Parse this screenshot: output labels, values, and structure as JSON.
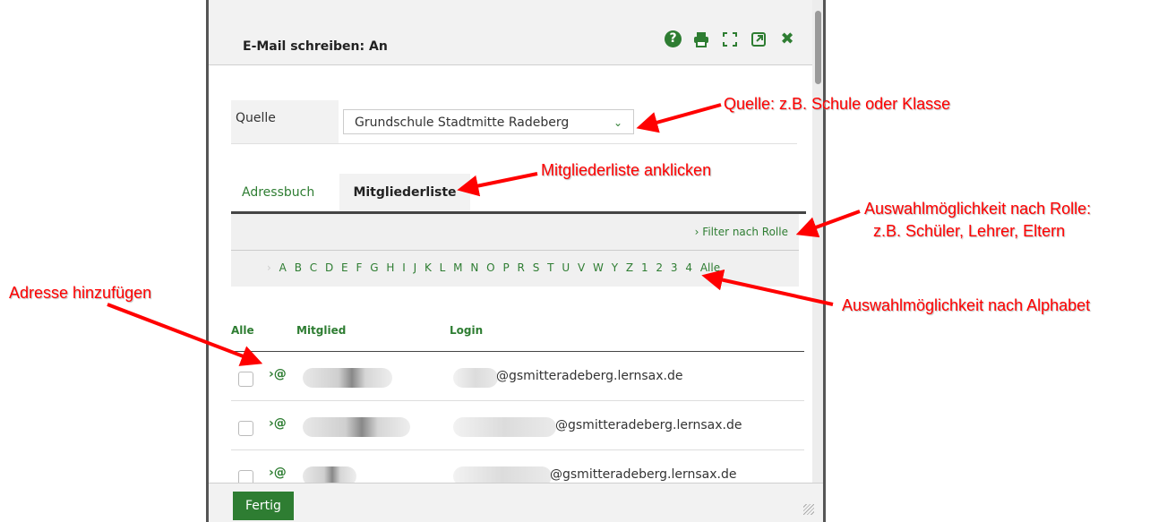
{
  "dialog": {
    "title": "E-Mail schreiben: An",
    "toolbar_icons": [
      "help-icon",
      "print-icon",
      "fullscreen-icon",
      "external-link-icon",
      "close-icon"
    ]
  },
  "source": {
    "label": "Quelle",
    "selected": "Grundschule Stadtmitte Radeberg"
  },
  "tabs": [
    {
      "label": "Adressbuch",
      "active": false
    },
    {
      "label": "Mitgliederliste",
      "active": true
    }
  ],
  "filter": {
    "label": "› Filter nach Rolle"
  },
  "alphabet": [
    "›",
    "A",
    "B",
    "C",
    "D",
    "E",
    "F",
    "G",
    "H",
    "I",
    "J",
    "K",
    "L",
    "M",
    "N",
    "O",
    "P",
    "R",
    "S",
    "T",
    "U",
    "V",
    "W",
    "Y",
    "Z",
    "1",
    "2",
    "3",
    "4",
    "Alle"
  ],
  "table": {
    "headers": {
      "all": "Alle",
      "member": "Mitglied",
      "login": "Login"
    },
    "add_label": "›@",
    "rows": [
      {
        "login_domain": "@gsmitteradeberg.lernsax.de"
      },
      {
        "login_domain": "@gsmitteradeberg.lernsax.de"
      },
      {
        "login_domain": "@gsmitteradeberg.lernsax.de"
      }
    ]
  },
  "footer": {
    "done_label": "Fertig"
  },
  "annotations": {
    "source": "Quelle: z.B. Schule oder Klasse",
    "members": "Mitgliederliste anklicken",
    "role_1": "Auswahlmöglichkeit nach Rolle:",
    "role_2": "z.B. Schüler, Lehrer, Eltern",
    "alphabet": "Auswahlmöglichkeit nach Alphabet",
    "add": "Adresse hinzufügen"
  },
  "colors": {
    "accent": "#2e7d32",
    "annotation": "#ff0000"
  }
}
